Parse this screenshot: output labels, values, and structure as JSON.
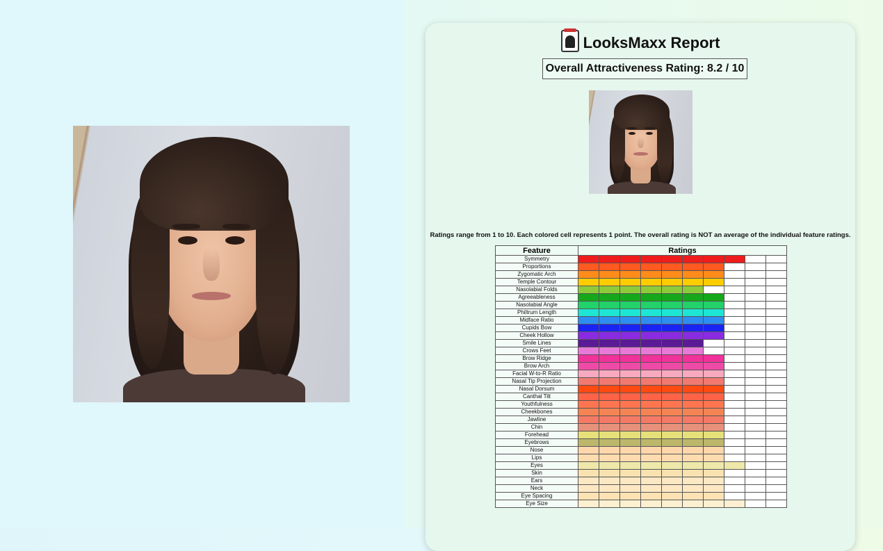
{
  "report": {
    "title": "LooksMaxx Report",
    "overall_rating": "Overall Attractiveness Rating: 8.2 / 10",
    "note": "Ratings range from 1 to 10. Each colored cell represents 1 point. The overall rating is NOT an average of the individual feature ratings.",
    "table_headers": {
      "feature": "Feature",
      "ratings": "Ratings"
    },
    "max_score": 10,
    "features": [
      {
        "name": "Symmetry",
        "score": 8,
        "color": "#ee1c1c"
      },
      {
        "name": "Proportions",
        "score": 7,
        "color": "#ff5a1f"
      },
      {
        "name": "Zygomatic Arch",
        "score": 7,
        "color": "#ff8c1a"
      },
      {
        "name": "Temple Contour",
        "score": 7,
        "color": "#ffcc00"
      },
      {
        "name": "Nasolabial Folds",
        "score": 6,
        "color": "#8ecb3a"
      },
      {
        "name": "Agreeableness",
        "score": 7,
        "color": "#14a81a"
      },
      {
        "name": "Nasolabial Angle",
        "score": 7,
        "color": "#22d16a"
      },
      {
        "name": "Philtrum Length",
        "score": 7,
        "color": "#1ee6d4"
      },
      {
        "name": "Midface Ratio",
        "score": 7,
        "color": "#2e8ef0"
      },
      {
        "name": "Cupids Bow",
        "score": 7,
        "color": "#1a24f2"
      },
      {
        "name": "Cheek Hollow",
        "score": 7,
        "color": "#8a2be2"
      },
      {
        "name": "Smile Lines",
        "score": 6,
        "color": "#5b1a96"
      },
      {
        "name": "Crows Feet",
        "score": 6,
        "color": "#e879d8"
      },
      {
        "name": "Brow Ridge",
        "score": 7,
        "color": "#f0329a"
      },
      {
        "name": "Brow Arch",
        "score": 7,
        "color": "#f04aa8"
      },
      {
        "name": "Facial W-to-R Ratio",
        "score": 7,
        "color": "#f7a9bf"
      },
      {
        "name": "Nasal Tip Projection",
        "score": 7,
        "color": "#f07a72"
      },
      {
        "name": "Nasal Dorsum",
        "score": 7,
        "color": "#ff4a12"
      },
      {
        "name": "Canthal Tilt",
        "score": 7,
        "color": "#ff6347"
      },
      {
        "name": "Youthfulness",
        "score": 7,
        "color": "#ff7550"
      },
      {
        "name": "Cheekbones",
        "score": 7,
        "color": "#f58455"
      },
      {
        "name": "Jawline",
        "score": 7,
        "color": "#f47a66"
      },
      {
        "name": "Chin",
        "score": 7,
        "color": "#e8917a"
      },
      {
        "name": "Forehead",
        "score": 7,
        "color": "#e6e07a"
      },
      {
        "name": "Eyebrows",
        "score": 7,
        "color": "#bdb76b"
      },
      {
        "name": "Nose",
        "score": 7,
        "color": "#ffd7aa"
      },
      {
        "name": "Lips",
        "score": 7,
        "color": "#ffdcb0"
      },
      {
        "name": "Eyes",
        "score": 8,
        "color": "#eee8aa"
      },
      {
        "name": "Skin",
        "score": 7,
        "color": "#f7e2b0"
      },
      {
        "name": "Ears",
        "score": 7,
        "color": "#fde8c4"
      },
      {
        "name": "Neck",
        "score": 7,
        "color": "#fde8c4"
      },
      {
        "name": "Eye Spacing",
        "score": 7,
        "color": "#fde3b4"
      },
      {
        "name": "Eye Size",
        "score": 8,
        "color": "#fdf0d0"
      }
    ]
  }
}
